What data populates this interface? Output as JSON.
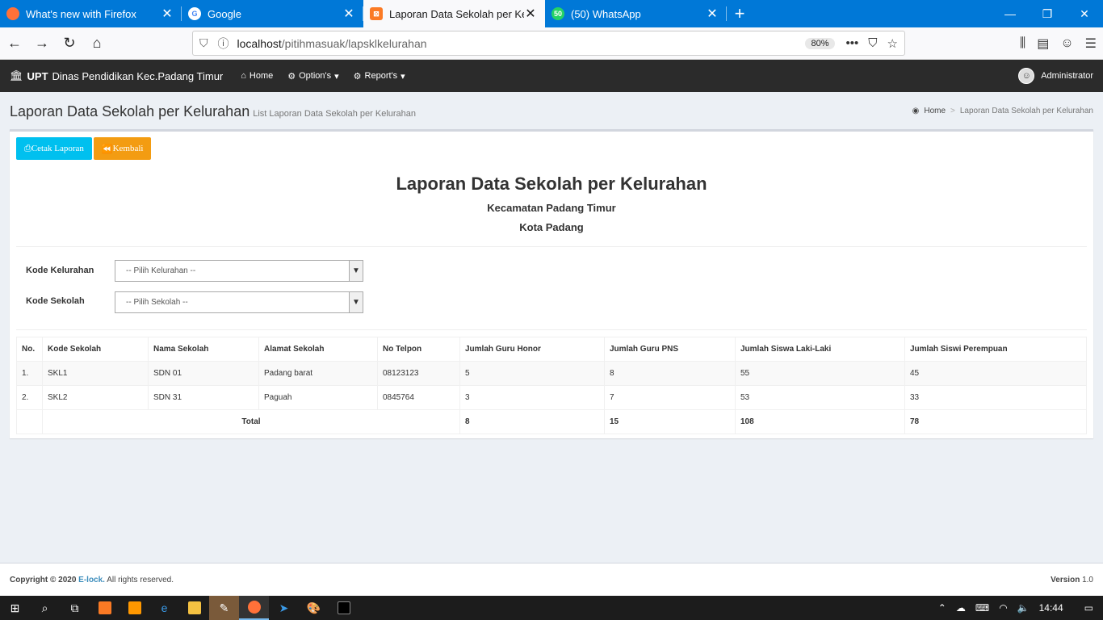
{
  "browser": {
    "tabs": [
      {
        "title": "What's new with Firefox",
        "icon": "firefox-icon",
        "color": "#ff7139"
      },
      {
        "title": "Google",
        "icon": "google-icon",
        "color": "#4285f4"
      },
      {
        "title": "Laporan Data Sekolah per Kelurahan",
        "icon": "xampp-icon",
        "color": "#fb7a24"
      },
      {
        "title": "(50) WhatsApp",
        "icon": "whatsapp-icon",
        "color": "#25d366"
      }
    ],
    "url_host": "localhost",
    "url_path": "/pitihmasuak/lapsklkelurahan",
    "zoom": "80%"
  },
  "app": {
    "brand_bold": "UPT",
    "brand_rest": "Dinas Pendidikan Kec.Padang Timur",
    "menu": {
      "home": "Home",
      "options": "Option's",
      "reports": "Report's"
    },
    "user": "Administrator"
  },
  "page": {
    "title": "Laporan Data Sekolah per Kelurahan",
    "subtitle": "List Laporan Data Sekolah per Kelurahan",
    "breadcrumb_home": "Home",
    "breadcrumb_current": "Laporan Data Sekolah per Kelurahan"
  },
  "report": {
    "btn_print": "Cetak Laporan",
    "btn_back": "Kembali",
    "title": "Laporan Data Sekolah per Kelurahan",
    "kecamatan": "Kecamatan Padang Timur",
    "kota": "Kota Padang",
    "filter_kelurahan_label": "Kode Kelurahan",
    "filter_kelurahan_value": "-- Pilih Kelurahan --",
    "filter_sekolah_label": "Kode Sekolah",
    "filter_sekolah_value": "-- Pilih Sekolah --"
  },
  "table": {
    "headers": [
      "No.",
      "Kode Sekolah",
      "Nama Sekolah",
      "Alamat Sekolah",
      "No Telpon",
      "Jumlah Guru Honor",
      "Jumlah Guru PNS",
      "Jumlah Siswa Laki-Laki",
      "Jumlah Siswi Perempuan"
    ],
    "rows": [
      [
        "1.",
        "SKL1",
        "SDN 01",
        "Padang barat",
        "08123123",
        "5",
        "8",
        "55",
        "45"
      ],
      [
        "2.",
        "SKL2",
        "SDN 31",
        "Paguah",
        "0845764",
        "3",
        "7",
        "53",
        "33"
      ]
    ],
    "total_label": "Total",
    "totals": [
      "8",
      "15",
      "108",
      "78"
    ]
  },
  "footer": {
    "copyright_prefix": "Copyright © 2020",
    "company": "E-lock.",
    "rights": "All rights reserved.",
    "version_label": "Version",
    "version": "1.0"
  },
  "taskbar": {
    "time": "14:44"
  }
}
